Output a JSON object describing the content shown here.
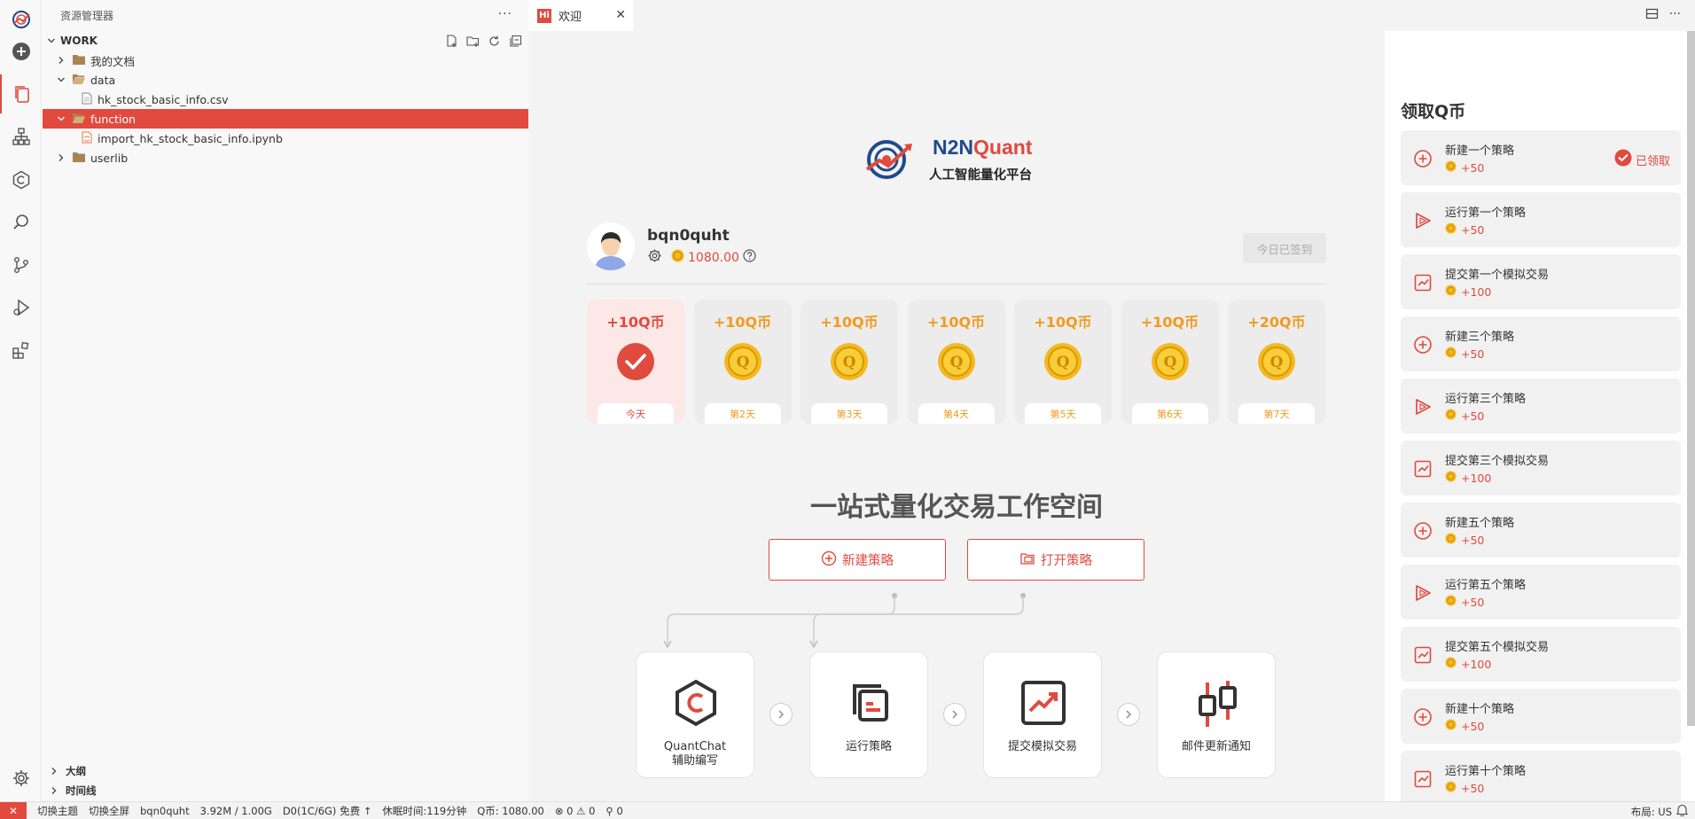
{
  "activity_bar": {
    "items": [
      "logo-icon",
      "new-icon",
      "explorer-icon",
      "structure-icon",
      "quantchat-icon",
      "search-icon",
      "source-control-icon",
      "run-debug-icon",
      "extensions-icon",
      "settings-icon"
    ]
  },
  "sidebar": {
    "title": "资源管理器",
    "more": "···",
    "workspace": "WORK",
    "tree": [
      {
        "label": "我的文档",
        "type": "folder",
        "expanded": false
      },
      {
        "label": "data",
        "type": "folder",
        "expanded": true
      },
      {
        "label": "hk_stock_basic_info.csv",
        "type": "file"
      },
      {
        "label": "function",
        "type": "folder",
        "expanded": true,
        "selected": true
      },
      {
        "label": "import_hk_stock_basic_info.ipynb",
        "type": "notebook"
      },
      {
        "label": "userlib",
        "type": "folder",
        "expanded": false
      }
    ],
    "outline": "大纲",
    "timeline": "时间线"
  },
  "tabs": [
    {
      "icon_text": "Hi",
      "label": "欢迎"
    }
  ],
  "welcome": {
    "logo_n2n": "N2N",
    "logo_quant": "Quant",
    "logo_sub": "人工智能量化平台",
    "username": "bqn0quht",
    "coins": "1080.00",
    "signed_label": "今日已签到",
    "days": [
      {
        "amount": "+10Q币",
        "label": "今天",
        "today": true
      },
      {
        "amount": "+10Q币",
        "label": "第2天"
      },
      {
        "amount": "+10Q币",
        "label": "第3天"
      },
      {
        "amount": "+10Q币",
        "label": "第4天"
      },
      {
        "amount": "+10Q币",
        "label": "第5天"
      },
      {
        "amount": "+10Q币",
        "label": "第6天"
      },
      {
        "amount": "+20Q币",
        "label": "第7天"
      }
    ],
    "headline": "一站式量化交易工作空间",
    "new_strategy": "新建策略",
    "open_strategy": "打开策略",
    "cards": [
      {
        "line1": "QuantChat",
        "line2": "辅助编写"
      },
      {
        "line1": "运行策略",
        "line2": ""
      },
      {
        "line1": "提交模拟交易",
        "line2": ""
      },
      {
        "line1": "邮件更新通知",
        "line2": ""
      }
    ]
  },
  "rewards": {
    "title": "领取Q币",
    "claimed_label": "已领取",
    "items": [
      {
        "name": "新建一个策略",
        "points": "+50",
        "icon": "plus",
        "claimed": true
      },
      {
        "name": "运行第一个策略",
        "points": "+50",
        "icon": "play"
      },
      {
        "name": "提交第一个模拟交易",
        "points": "+100",
        "icon": "chart"
      },
      {
        "name": "新建三个策略",
        "points": "+50",
        "icon": "plus"
      },
      {
        "name": "运行第三个策略",
        "points": "+50",
        "icon": "play"
      },
      {
        "name": "提交第三个模拟交易",
        "points": "+100",
        "icon": "chart"
      },
      {
        "name": "新建五个策略",
        "points": "+50",
        "icon": "plus"
      },
      {
        "name": "运行第五个策略",
        "points": "+50",
        "icon": "play"
      },
      {
        "name": "提交第五个模拟交易",
        "points": "+100",
        "icon": "chart"
      },
      {
        "name": "新建十个策略",
        "points": "+50",
        "icon": "plus"
      },
      {
        "name": "运行第十个策略",
        "points": "+50",
        "icon": "chart"
      }
    ]
  },
  "status_bar": {
    "remote": "✕",
    "theme": "切换主题",
    "fullscreen": "切换全屏",
    "user": "bqn0quht",
    "memory": "3.92M / 1.00G",
    "plan": "D0(1C/6G) 免费 ↑",
    "sleep": "休眠时间:119分钟",
    "coins": "Q币: 1080.00",
    "problems": "⊗ 0 ⚠ 0",
    "ports": "⚲ 0",
    "layout": "布局: US"
  },
  "colors": {
    "accent": "#e04a3f",
    "coin": "#f29a1f",
    "brand_blue": "#1f4a8c"
  }
}
